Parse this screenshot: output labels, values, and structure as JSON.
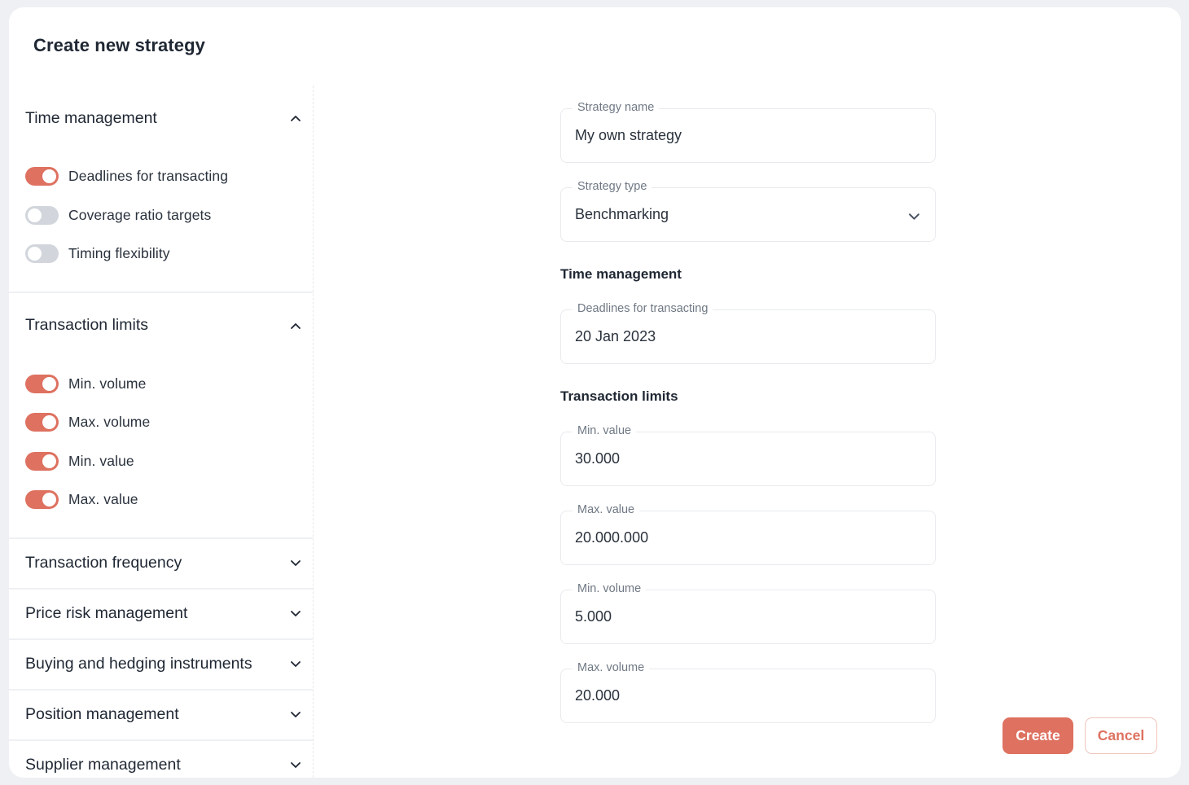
{
  "page": {
    "title": "Create new strategy"
  },
  "sidebar": {
    "sections": [
      {
        "label": "Time management",
        "expanded": true,
        "icon": "chevron-up-icon",
        "toggles": [
          {
            "label": "Deadlines for transacting",
            "on": true
          },
          {
            "label": "Coverage ratio targets",
            "on": false
          },
          {
            "label": "Timing flexibility",
            "on": false
          }
        ]
      },
      {
        "label": "Transaction limits",
        "expanded": true,
        "icon": "chevron-up-icon",
        "toggles": [
          {
            "label": "Min. volume",
            "on": true
          },
          {
            "label": "Max. volume",
            "on": true
          },
          {
            "label": "Min. value",
            "on": true
          },
          {
            "label": "Max. value",
            "on": true
          }
        ]
      },
      {
        "label": "Transaction frequency",
        "expanded": false,
        "icon": "chevron-down-icon"
      },
      {
        "label": "Price risk management",
        "expanded": false,
        "icon": "chevron-down-icon"
      },
      {
        "label": "Buying and hedging instruments",
        "expanded": false,
        "icon": "chevron-down-icon"
      },
      {
        "label": "Position management",
        "expanded": false,
        "icon": "chevron-down-icon"
      },
      {
        "label": "Supplier management",
        "expanded": false,
        "icon": "chevron-down-icon"
      }
    ]
  },
  "form": {
    "strategy_name": {
      "label": "Strategy name",
      "value": "My own strategy"
    },
    "strategy_type": {
      "label": "Strategy type",
      "value": "Benchmarking",
      "icon": "chevron-down-icon"
    },
    "time_management": {
      "title": "Time management",
      "deadlines": {
        "label": "Deadlines for transacting",
        "value": "20 Jan 2023"
      }
    },
    "transaction_limits": {
      "title": "Transaction limits",
      "min_value": {
        "label": "Min. value",
        "value": "30.000"
      },
      "max_value": {
        "label": "Max. value",
        "value": "20.000.000"
      },
      "min_volume": {
        "label": "Min. volume",
        "value": "5.000"
      },
      "max_volume": {
        "label": "Max. volume",
        "value": "20.000"
      }
    }
  },
  "actions": {
    "create_label": "Create",
    "cancel_label": "Cancel"
  },
  "colors": {
    "accent": "#de7160",
    "toggle_off": "#d2d6dc",
    "text": "#1f2733",
    "background": "#eef0f3"
  }
}
